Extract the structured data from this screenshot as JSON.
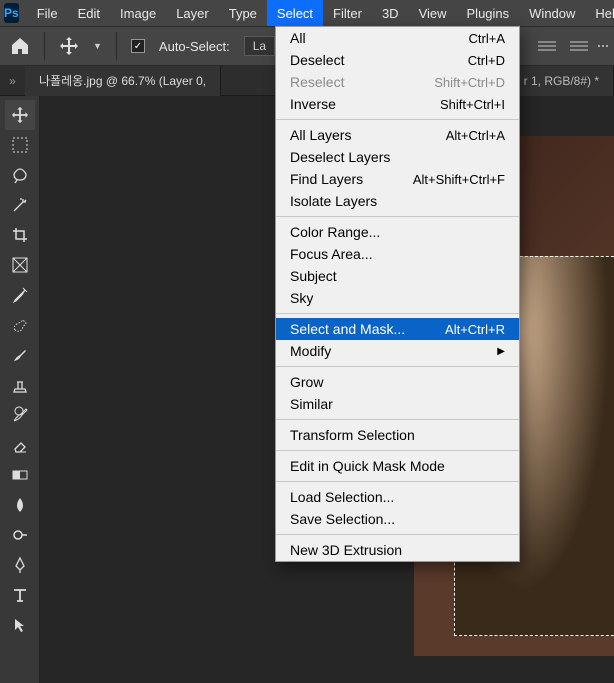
{
  "app_badge": "Ps",
  "menu": {
    "file": "File",
    "edit": "Edit",
    "image": "Image",
    "layer": "Layer",
    "type": "Type",
    "select": "Select",
    "filter": "Filter",
    "three_d": "3D",
    "view": "View",
    "plugins": "Plugins",
    "window": "Window",
    "help": "Help"
  },
  "options": {
    "auto_select": "Auto-Select:",
    "layer_drop": "La"
  },
  "tabs": {
    "active": "나폴레옹.jpg @ 66.7% (Layer 0,",
    "background": "r 1, RGB/8#) *"
  },
  "select_menu": {
    "all": {
      "label": "All",
      "sc": "Ctrl+A"
    },
    "deselect": {
      "label": "Deselect",
      "sc": "Ctrl+D"
    },
    "reselect": {
      "label": "Reselect",
      "sc": "Shift+Ctrl+D"
    },
    "inverse": {
      "label": "Inverse",
      "sc": "Shift+Ctrl+I"
    },
    "all_layers": {
      "label": "All Layers",
      "sc": "Alt+Ctrl+A"
    },
    "deselect_layers": {
      "label": "Deselect Layers",
      "sc": ""
    },
    "find_layers": {
      "label": "Find Layers",
      "sc": "Alt+Shift+Ctrl+F"
    },
    "isolate_layers": {
      "label": "Isolate Layers",
      "sc": ""
    },
    "color_range": {
      "label": "Color Range...",
      "sc": ""
    },
    "focus_area": {
      "label": "Focus Area...",
      "sc": ""
    },
    "subject": {
      "label": "Subject",
      "sc": ""
    },
    "sky": {
      "label": "Sky",
      "sc": ""
    },
    "select_mask": {
      "label": "Select and Mask...",
      "sc": "Alt+Ctrl+R"
    },
    "modify": {
      "label": "Modify",
      "sc": ""
    },
    "grow": {
      "label": "Grow",
      "sc": ""
    },
    "similar": {
      "label": "Similar",
      "sc": ""
    },
    "transform_sel": {
      "label": "Transform Selection",
      "sc": ""
    },
    "quick_mask": {
      "label": "Edit in Quick Mask Mode",
      "sc": ""
    },
    "load_sel": {
      "label": "Load Selection...",
      "sc": ""
    },
    "save_sel": {
      "label": "Save Selection...",
      "sc": ""
    },
    "new_3d": {
      "label": "New 3D Extrusion",
      "sc": ""
    }
  }
}
